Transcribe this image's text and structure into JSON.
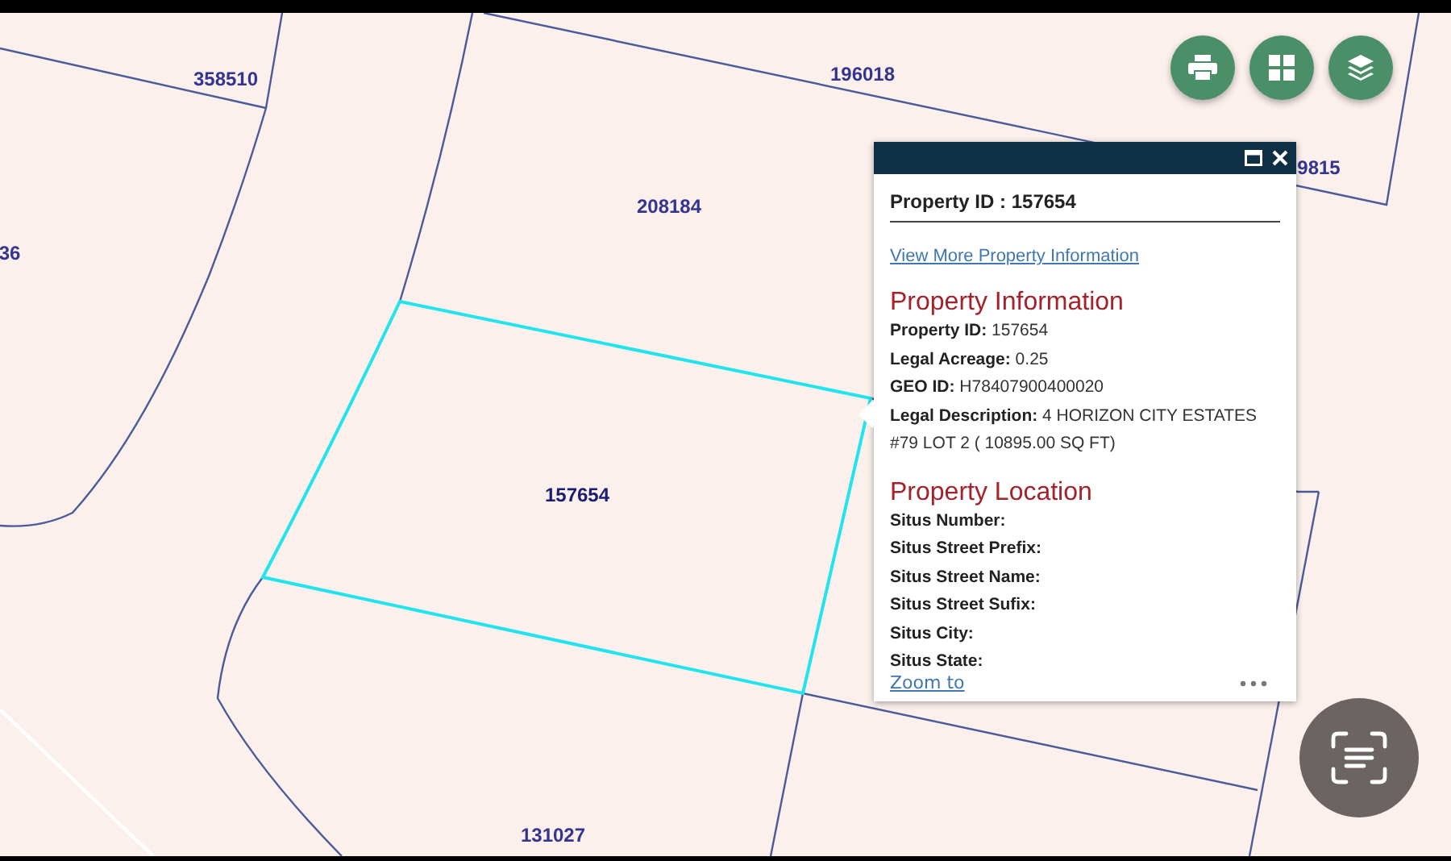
{
  "map": {
    "parcel_labels": [
      {
        "text": "358510",
        "selected": false
      },
      {
        "text": "196018",
        "selected": false
      },
      {
        "text": "208184",
        "selected": false
      },
      {
        "text": "36",
        "selected": false
      },
      {
        "text": "9815",
        "selected": false
      },
      {
        "text": "157654",
        "selected": true
      },
      {
        "text": "131027",
        "selected": false
      }
    ]
  },
  "popup": {
    "title": "Property ID : 157654",
    "link": "View More Property Information",
    "sections": [
      {
        "heading": "Property Information",
        "fields": [
          "**Property ID:** 157654",
          "**Legal Acreage:** 0.25",
          "**GEO ID:** H78407900400020",
          "**Legal Description:** 4 HORIZON CITY ESTATES #79 LOT 2 ( 10895.00 SQ FT)"
        ]
      },
      {
        "heading": "Property Location",
        "fields": [
          "**Situs Number:**",
          "**Situs Street Prefix:**",
          "**Situs Street Name:**",
          "**Situs Street Sufix:**",
          "**Situs City:**",
          "**Situs State:**"
        ]
      }
    ],
    "footer_link": "Zoom to"
  }
}
